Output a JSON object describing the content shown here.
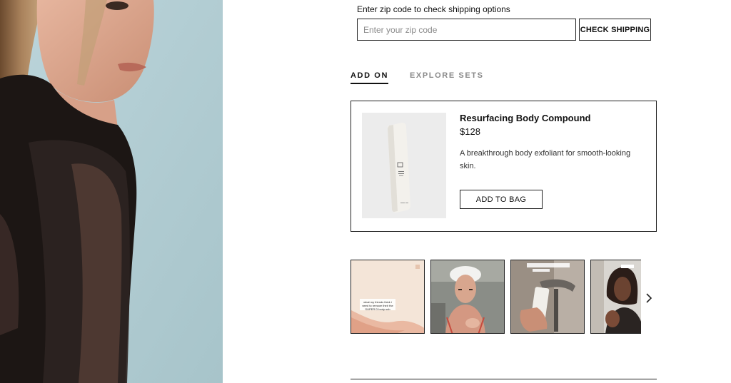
{
  "shipping": {
    "label": "Enter zip code to check shipping options",
    "zip_placeholder": "Enter your zip code",
    "zip_value": "",
    "check_button": "CHECK SHIPPING"
  },
  "tabs": [
    {
      "label": "ADD ON",
      "active": true
    },
    {
      "label": "EXPLORE SETS",
      "active": false
    }
  ],
  "addon": {
    "name": "Resurfacing Body Compound",
    "price": "$128",
    "description": "A breakthrough body exfoliant for smooth-looking skin.",
    "button": "ADD TO BAG"
  },
  "videos": [
    {
      "caption": "what my friends think i need to remove their the SUPER D body sub"
    },
    {
      "caption": ""
    },
    {
      "caption": ""
    },
    {
      "caption": ""
    }
  ],
  "icons": {
    "next": "chevron-right-icon"
  }
}
